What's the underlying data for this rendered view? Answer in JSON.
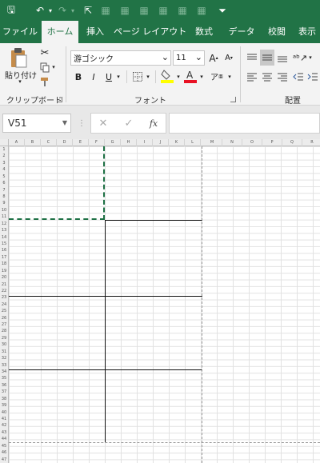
{
  "qat": {
    "items": [
      {
        "name": "save-icon",
        "glyph": "🖫"
      },
      {
        "name": "undo-icon",
        "glyph": "↶"
      },
      {
        "name": "undo-dropdown-icon",
        "glyph": "▾"
      },
      {
        "name": "redo-icon",
        "glyph": "↷"
      },
      {
        "name": "redo-dropdown-icon",
        "glyph": "▾"
      },
      {
        "name": "select-objects-icon",
        "glyph": "⇱"
      },
      {
        "name": "qat-icon-1",
        "glyph": "▦"
      },
      {
        "name": "qat-icon-2",
        "glyph": "▦"
      },
      {
        "name": "qat-icon-3",
        "glyph": "▦"
      },
      {
        "name": "qat-icon-4",
        "glyph": "▦"
      },
      {
        "name": "qat-icon-5",
        "glyph": "▦"
      },
      {
        "name": "qat-icon-6",
        "glyph": "▦"
      },
      {
        "name": "customize-qat-icon",
        "glyph": "⏷"
      }
    ]
  },
  "tabs": [
    "ファイル",
    "ホーム",
    "挿入",
    "ページ レイアウト",
    "数式",
    "データ",
    "校閲",
    "表示"
  ],
  "active_tab": "ホーム",
  "clipboard": {
    "paste_label": "貼り付け",
    "group_label": "クリップボード"
  },
  "font": {
    "name": "游ゴシック",
    "size": "11",
    "group_label": "フォント",
    "bold": "B",
    "italic": "I",
    "underline": "U",
    "grow": "A",
    "shrink": "A"
  },
  "alignment": {
    "group_label": "配置"
  },
  "formula_bar": {
    "name_box": "V51",
    "cancel": "✕",
    "enter": "✓",
    "fx": "fx",
    "value": ""
  },
  "sheet": {
    "columns": [
      "A",
      "B",
      "C",
      "D",
      "E",
      "F",
      "G",
      "H",
      "I",
      "J",
      "K",
      "L",
      "M",
      "N",
      "O",
      "P",
      "Q",
      "R"
    ],
    "row_count": 47
  },
  "colors": {
    "accent": "#217346",
    "active_tab_bg": "#f3f3f3",
    "font_color_bar": "#e81123",
    "highlight_bar": "#ffff00",
    "copy_border": "#1e7145"
  }
}
